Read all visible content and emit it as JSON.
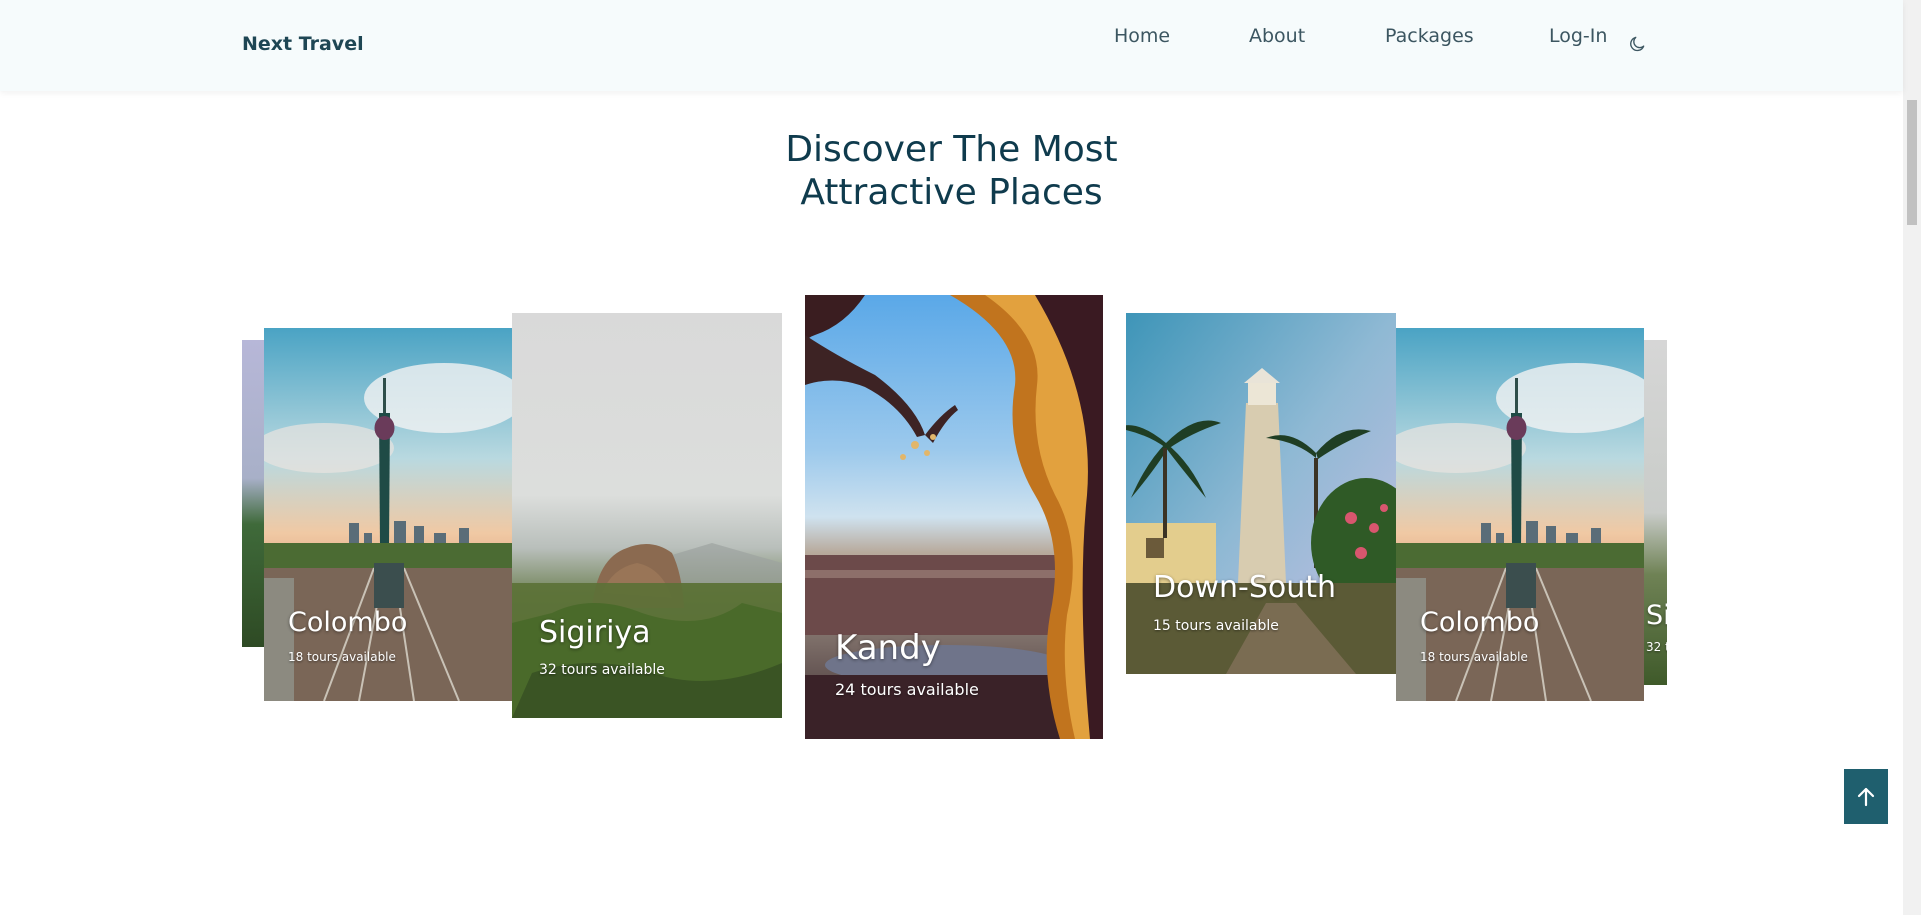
{
  "header": {
    "logo": "Next Travel",
    "nav": [
      "Home",
      "About",
      "Packages",
      "Log-In"
    ],
    "theme_icon": "moon-icon"
  },
  "section": {
    "title_line1": "Discover The Most",
    "title_line2": "Attractive Places"
  },
  "cards": [
    {
      "name": "Colombo",
      "tours": "18 tours available",
      "image": "colombo-lotus-tower-railway"
    },
    {
      "name": "Sigiriya",
      "tours": "32 tours available",
      "image": "sigiriya-rock"
    },
    {
      "name": "Kandy",
      "tours": "24 tours available",
      "image": "kandy-lake"
    },
    {
      "name": "Down-South",
      "tours": "15 tours available",
      "image": "galle-lighthouse"
    },
    {
      "name": "Colombo",
      "tours": "18 tours available",
      "image": "colombo-lotus-tower-railway"
    },
    {
      "name": "Si",
      "tours": "32 t",
      "image": "sigiriya-rock-partial"
    }
  ],
  "back_to_top_icon": "arrow-up-icon",
  "colors": {
    "header_bg": "#f6fbfc",
    "title": "#0f3b4d",
    "accent": "#1f5f6e"
  }
}
